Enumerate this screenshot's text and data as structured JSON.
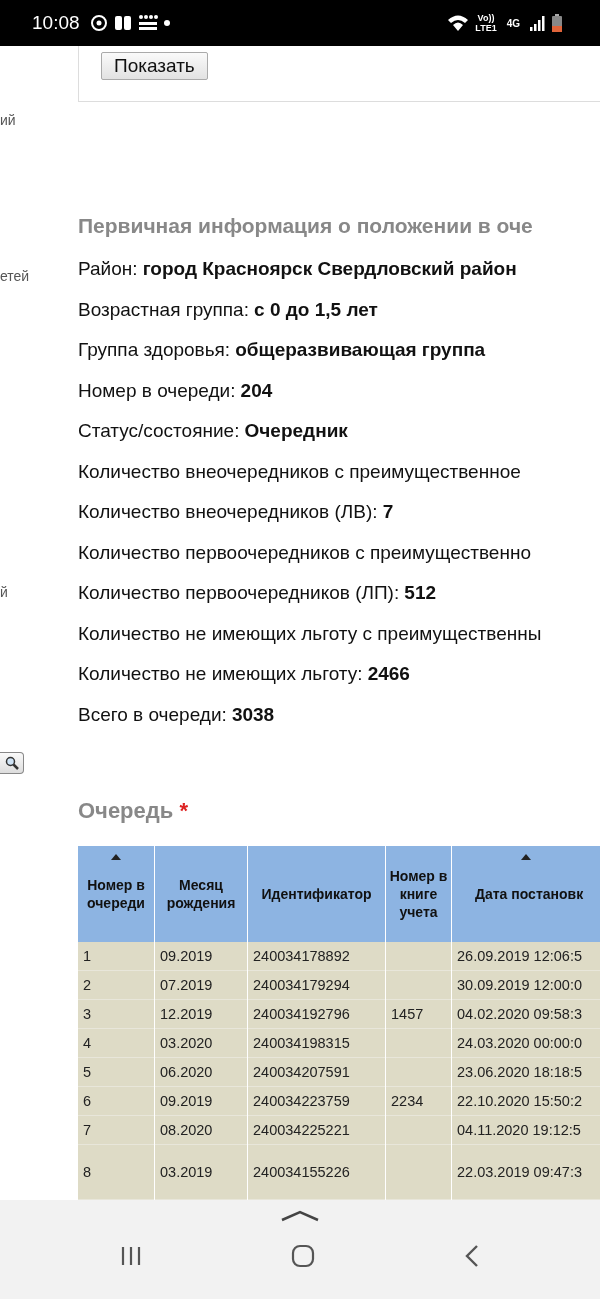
{
  "status_bar": {
    "time": "10:08",
    "volte": "Vo))",
    "lte": "LTE1",
    "network": "4G"
  },
  "side_fragments": [
    "ий",
    "етей",
    "й"
  ],
  "form": {
    "show_button": "Показать"
  },
  "info": {
    "title": "Первичная информация о положении в оче",
    "lines": [
      {
        "label": "Район:",
        "value": "город Красноярск Свердловский район"
      },
      {
        "label": "Возрастная группа:",
        "value": "с 0 до 1,5 лет"
      },
      {
        "label": "Группа здоровья:",
        "value": "общеразвивающая группа"
      },
      {
        "label": "Номер в очереди:",
        "value": "204"
      },
      {
        "label": "Статус/состояние:",
        "value": "Очередник"
      },
      {
        "label": "Количество внеочередников с преимущественное"
      },
      {
        "label": "Количество внеочередников (ЛВ):",
        "value": "7"
      },
      {
        "label": "Количество первоочередников с преимущественно"
      },
      {
        "label": "Количество первоочередников (ЛП):",
        "value": "512"
      },
      {
        "label": "Количество не имеющих льготу с преимущественны"
      },
      {
        "label": "Количество не имеющих льготу:",
        "value": "2466"
      },
      {
        "label": "Всего в очереди:",
        "value": "3038"
      }
    ]
  },
  "queue": {
    "title": "Очередь",
    "required_mark": "*",
    "columns": [
      {
        "label": "Номер в очереди",
        "sorted": true
      },
      {
        "label": "Месяц рождения",
        "sorted": false
      },
      {
        "label": "Идентификатор",
        "sorted": false
      },
      {
        "label": "Номер в книге учета",
        "sorted": false
      },
      {
        "label": "Дата постановк",
        "sorted": true
      }
    ],
    "rows": [
      [
        "1",
        "09.2019",
        "240034178892",
        "",
        "26.09.2019 12:06:5"
      ],
      [
        "2",
        "07.2019",
        "240034179294",
        "",
        "30.09.2019 12:00:0"
      ],
      [
        "3",
        "12.2019",
        "240034192796",
        "1457",
        "04.02.2020 09:58:3"
      ],
      [
        "4",
        "03.2020",
        "240034198315",
        "",
        "24.03.2020 00:00:0"
      ],
      [
        "5",
        "06.2020",
        "240034207591",
        "",
        "23.06.2020 18:18:5"
      ],
      [
        "6",
        "09.2019",
        "240034223759",
        "2234",
        "22.10.2020 15:50:2"
      ],
      [
        "7",
        "08.2020",
        "240034225221",
        "",
        "04.11.2020 19:12:5"
      ],
      [
        "8",
        "03.2019",
        "240034155226",
        "",
        "22.03.2019 09:47:3"
      ]
    ]
  }
}
